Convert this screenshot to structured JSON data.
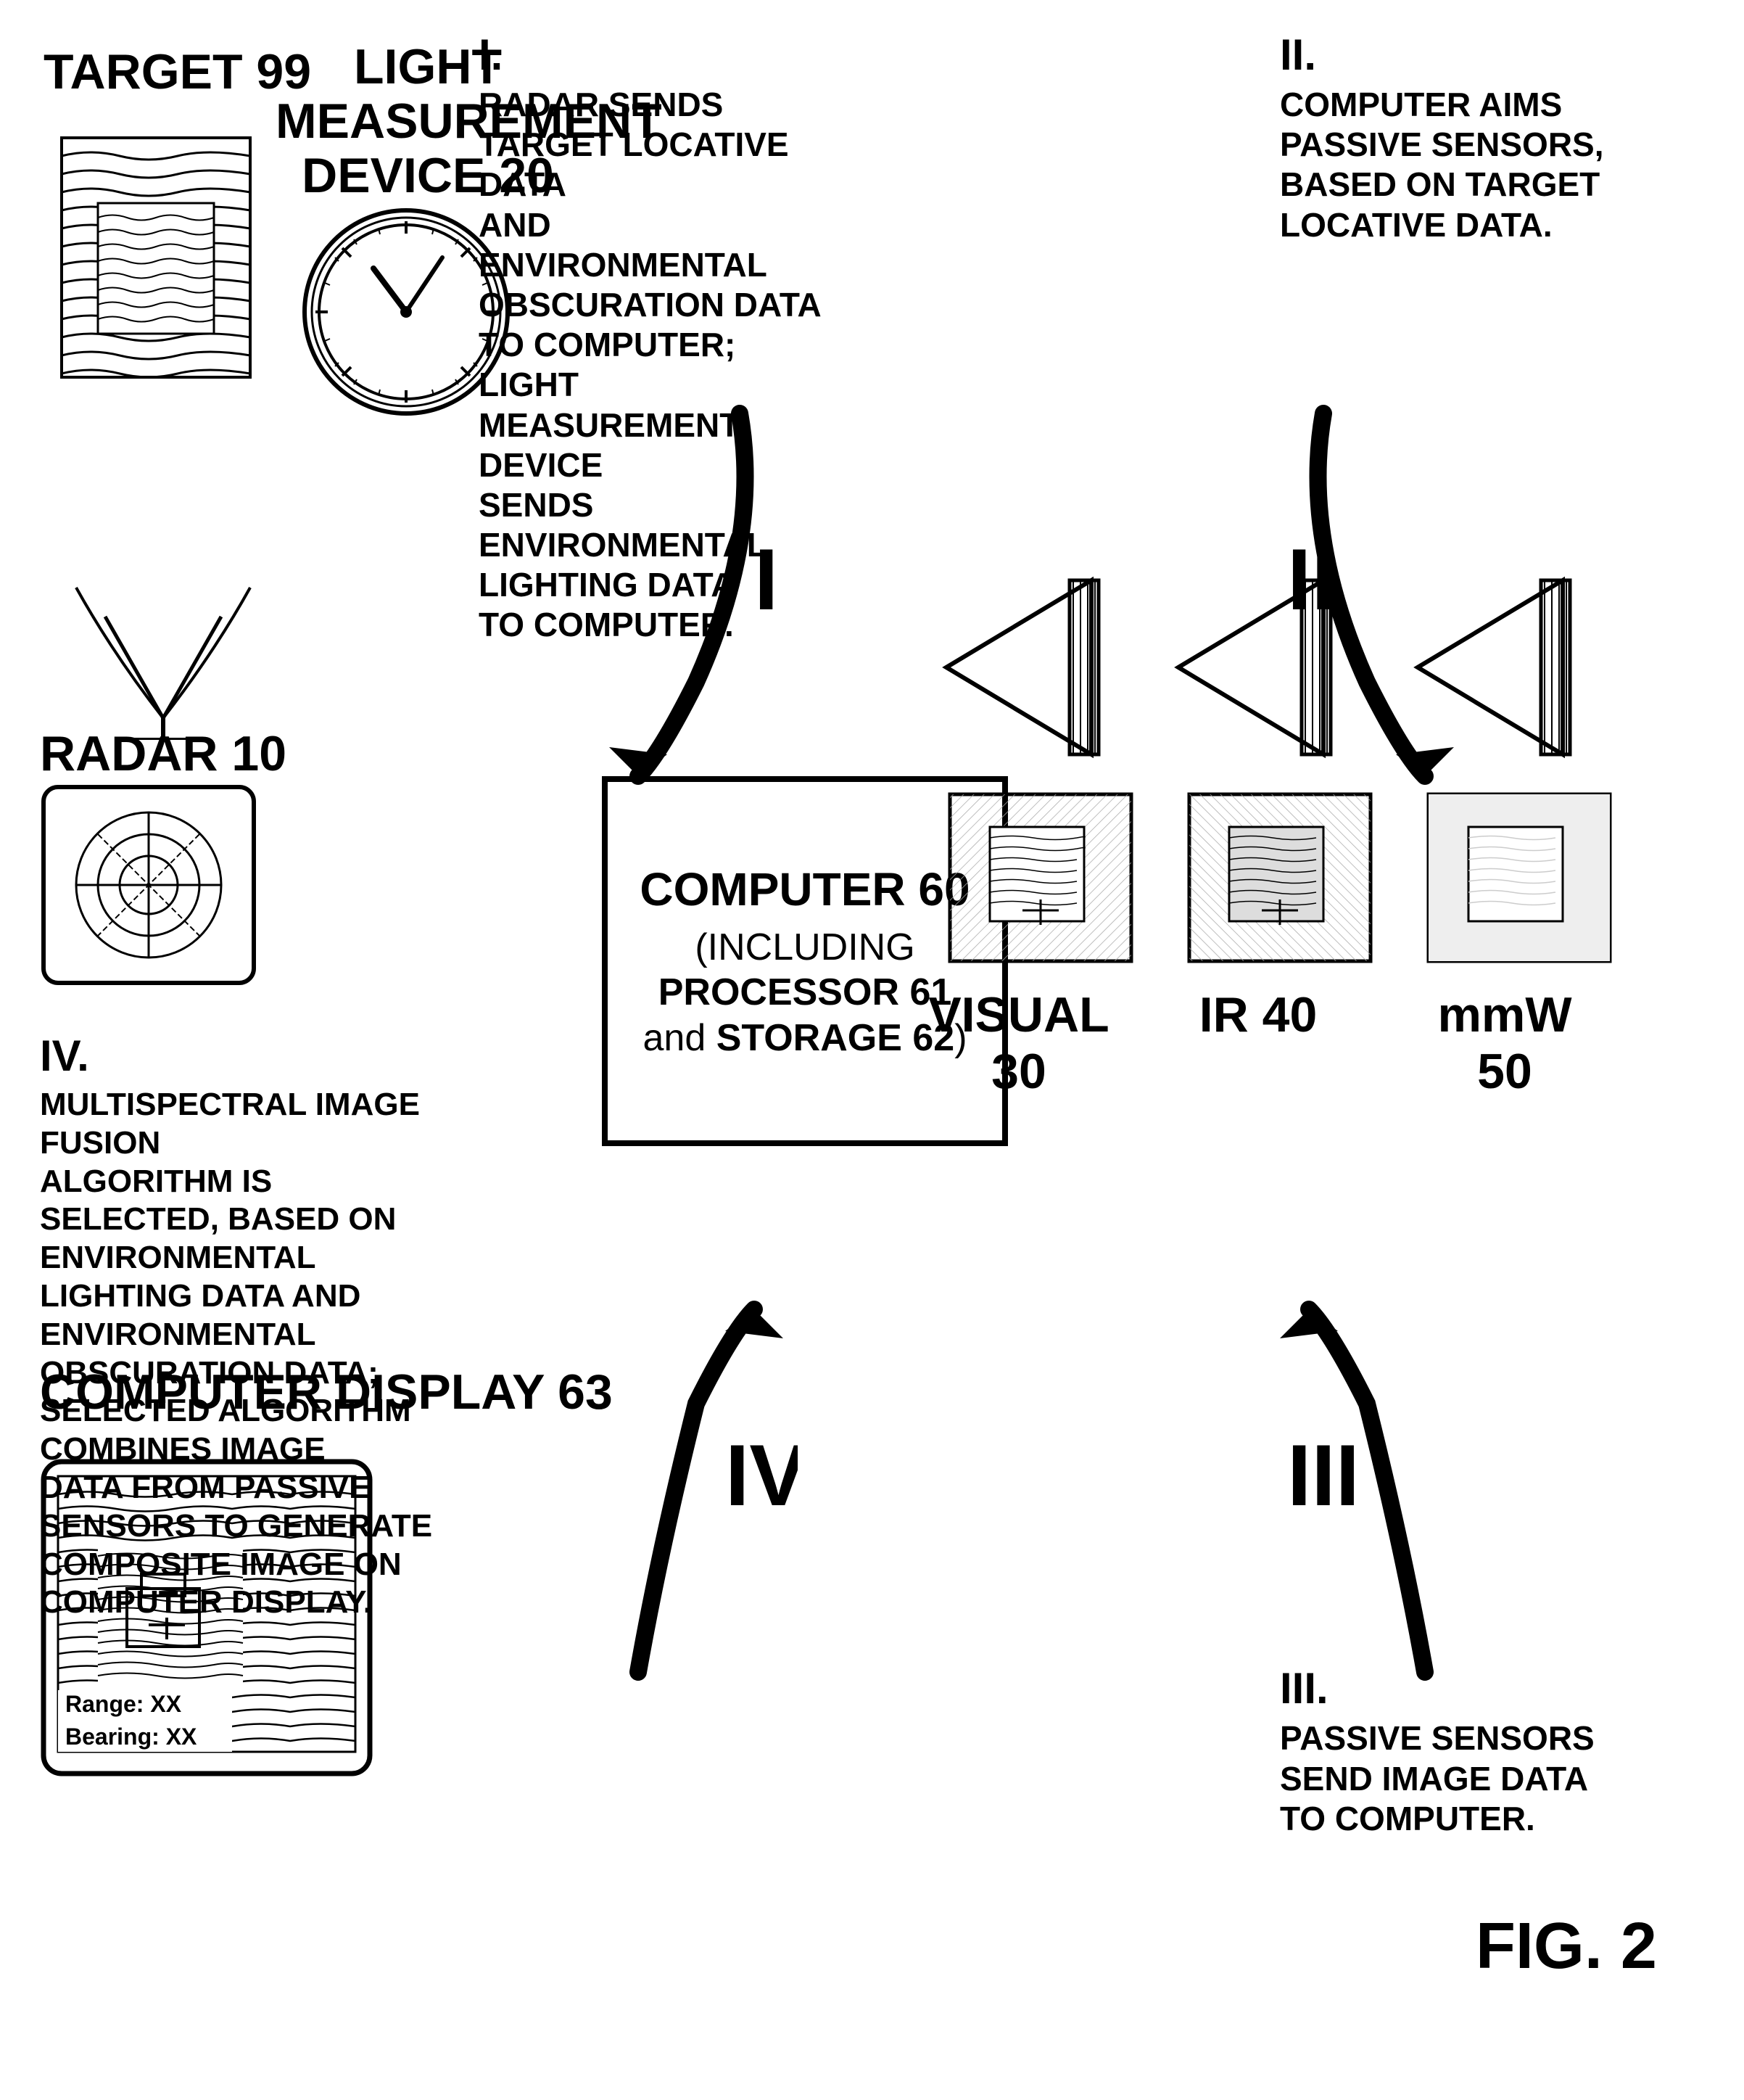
{
  "fig_label": "FIG. 2",
  "target": {
    "label": "TARGET 99"
  },
  "lmd": {
    "label": "LIGHT MEASUREMENT\nDEVICE 20"
  },
  "radar": {
    "label": "RADAR 10"
  },
  "computer_display": {
    "label": "COMPUTER DISPLAY 63",
    "range_label": "Range: XX",
    "bearing_label": "Bearing: XX"
  },
  "computer": {
    "label": "COMPUTER 60",
    "sublabel": "(INCLUDING PROCESSOR 61\nand STORAGE 62)"
  },
  "sensors": {
    "visual_label": "VISUAL 30",
    "ir_label": "IR 40",
    "mmw_label": "mmW 50"
  },
  "step_i": {
    "roman": "I.",
    "text": "RADAR SENDS\nTARGET LOCATIVE DATA\nAND ENVIRONMENTAL\nOBSCURATION DATA\nTO COMPUTER;\nLIGHT MEASUREMENT DEVICE\nSENDS ENVIRONMENTAL\nLIGHTING DATA\nTO COMPUTER."
  },
  "step_ii": {
    "roman": "II.",
    "text": "COMPUTER AIMS PASSIVE SENSORS,\nBASED ON TARGET LOCATIVE DATA."
  },
  "step_iii": {
    "roman": "III.",
    "text": "PASSIVE SENSORS\nSEND IMAGE DATA\nTO COMPUTER."
  },
  "step_iv": {
    "roman": "IV.",
    "text": "MULTISPECTRAL IMAGE FUSION\nALGORITHM IS SELECTED, BASED ON\nENVIRONMENTAL LIGHTING DATA AND\nENVIRONMENTAL OBSCURATION DATA;\nSELECTED ALGORITHM COMBINES IMAGE\nDATA FROM PASSIVE SENSORS TO GENERATE\nCOMPOSITE IMAGE ON COMPUTER DISPLAY."
  },
  "arrows": {
    "i_label": "I",
    "ii_label": "II",
    "iii_label": "III",
    "iv_label": "IV"
  }
}
